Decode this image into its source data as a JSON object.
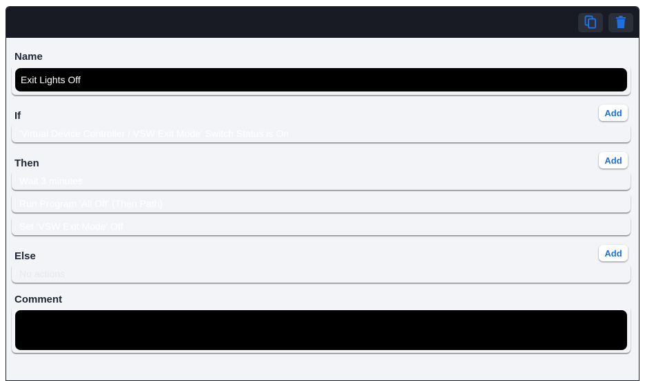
{
  "name": {
    "label": "Name",
    "value": "Exit Lights Off"
  },
  "if_section": {
    "label": "If",
    "add_label": "Add",
    "conditions": [
      "'Virtual Device Controller / VSW Exit Mode' Switch Status is On"
    ]
  },
  "then_section": {
    "label": "Then",
    "add_label": "Add",
    "actions": [
      "Wait 3 minutes",
      "Run Program 'All Off' (Then Path)",
      "Set 'VSW Exit Mode' Off"
    ]
  },
  "else_section": {
    "label": "Else",
    "add_label": "Add",
    "empty_text": "No actions"
  },
  "comment": {
    "label": "Comment",
    "value": ""
  },
  "icons": {
    "copy": "copy-icon",
    "delete": "trash-icon"
  },
  "colors": {
    "accent": "#1f6fe0",
    "header": "#181b23",
    "panel": "#f3f4f8"
  }
}
